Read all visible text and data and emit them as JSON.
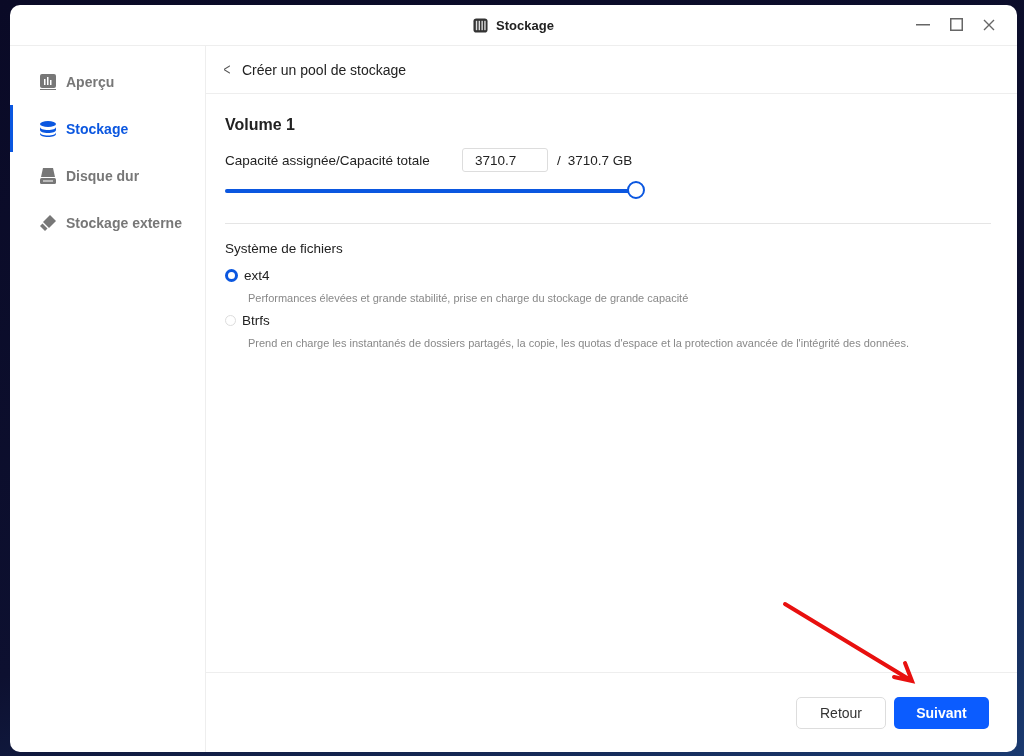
{
  "window": {
    "title": "Stockage"
  },
  "sidebar": {
    "items": [
      {
        "label": "Aperçu",
        "kind": "overview",
        "selected": false
      },
      {
        "label": "Stockage",
        "kind": "storage",
        "selected": true
      },
      {
        "label": "Disque dur",
        "kind": "disk",
        "selected": false
      },
      {
        "label": "Stockage externe",
        "kind": "external",
        "selected": false
      }
    ]
  },
  "header": {
    "back": "<",
    "title": "Créer un pool de stockage"
  },
  "volume": {
    "title": "Volume 1",
    "capacity_label": "Capacité assignée/Capacité totale",
    "capacity_value": "3710.7",
    "separator": "/",
    "total": "3710.7 GB",
    "level": 1
  },
  "filesystem": {
    "label": "Système de fichiers",
    "options": [
      {
        "name": "ext4",
        "description": "Performances élevées et grande stabilité, prise en charge du stockage de grande capacité",
        "selected": true
      },
      {
        "name": "Btrfs",
        "description": "Prend en charge les instantanés de dossiers partagés, la copie, les quotas d'espace et la protection avancée de l'intégrité des données.",
        "selected": false
      }
    ]
  },
  "buttons": [
    {
      "label": "Retour",
      "kind": "secondary"
    },
    {
      "label": "Suivant",
      "kind": "primary"
    }
  ]
}
